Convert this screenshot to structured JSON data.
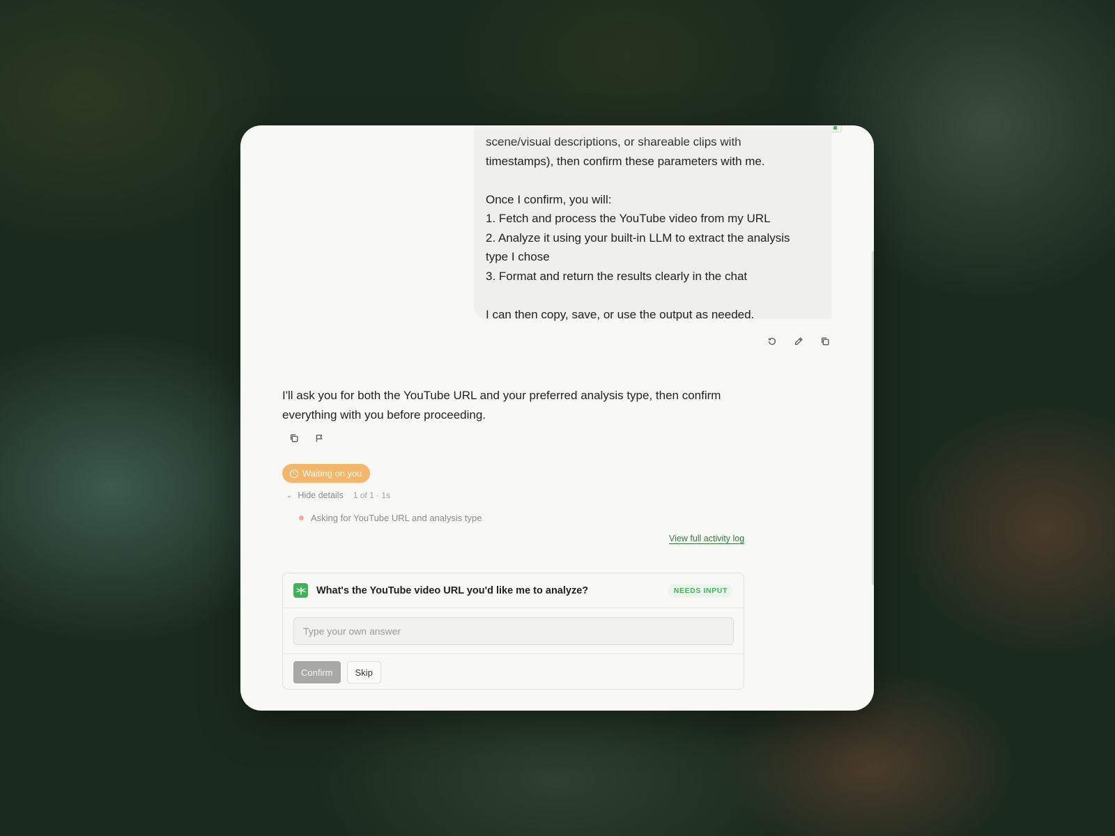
{
  "user_message": {
    "lines": [
      "scene/visual descriptions, or shareable clips with",
      "timestamps), then confirm these parameters with me.",
      "",
      "Once I confirm, you will:",
      "1. Fetch and process the YouTube video from my URL",
      "2. Analyze it using your built-in LLM to extract the analysis",
      "type I chose",
      "3. Format and return the results clearly in the chat",
      "",
      "I can then copy, save, or use the output as needed."
    ],
    "actions": [
      "retry-icon",
      "edit-icon",
      "copy-icon"
    ]
  },
  "assistant_message": {
    "text": "I'll ask you for both the YouTube URL and your preferred analysis type, then confirm everything with you before proceeding.",
    "actions": [
      "copy-icon",
      "flag-icon"
    ]
  },
  "status": {
    "label": "Waiting on you",
    "color": "#f3b66a"
  },
  "details": {
    "toggle_label": "Hide details",
    "meta": "1 of 1 · 1s",
    "steps": [
      {
        "label": "Asking for YouTube URL and analysis type"
      }
    ],
    "activity_link": "View full activity log"
  },
  "question_card": {
    "question": "What's the YouTube video URL you'd like me to analyze?",
    "badge": "NEEDS INPUT",
    "input": {
      "placeholder": "Type your own answer",
      "value": ""
    },
    "confirm_label": "Confirm",
    "skip_label": "Skip",
    "accent": "#3fb457"
  }
}
